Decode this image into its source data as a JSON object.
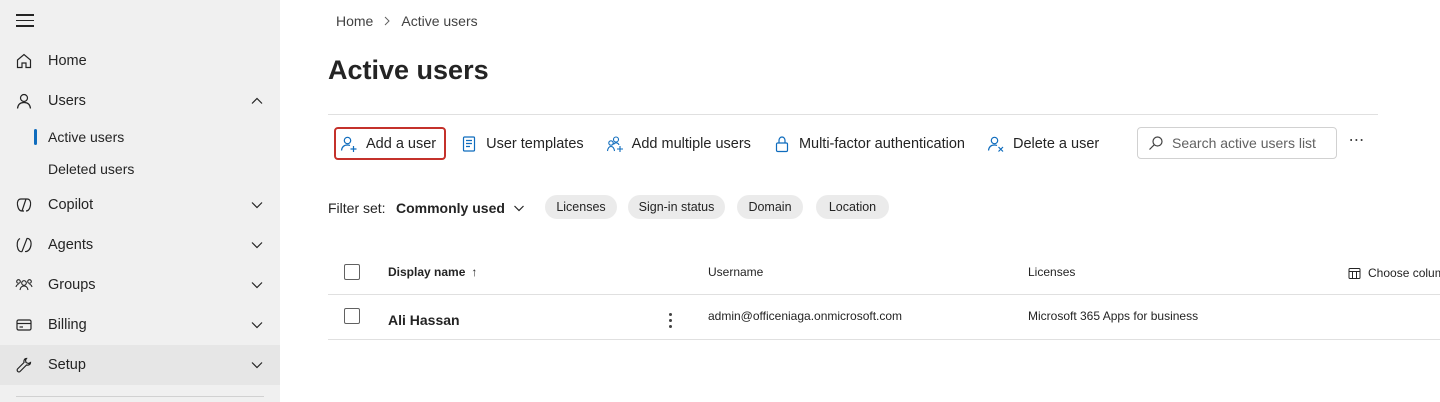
{
  "sidebar": {
    "menu_label": "Navigation menu",
    "items": [
      {
        "label": "Home"
      },
      {
        "label": "Users"
      },
      {
        "label": "Copilot"
      },
      {
        "label": "Agents"
      },
      {
        "label": "Groups"
      },
      {
        "label": "Billing"
      },
      {
        "label": "Setup"
      }
    ],
    "users_subitems": [
      {
        "label": "Active users"
      },
      {
        "label": "Deleted users"
      }
    ]
  },
  "breadcrumb": {
    "home": "Home",
    "current": "Active users"
  },
  "page": {
    "title": "Active users"
  },
  "toolbar": {
    "add_user": "Add a user",
    "user_templates": "User templates",
    "add_multiple": "Add multiple users",
    "mfa": "Multi-factor authentication",
    "delete_user": "Delete a user",
    "more": "⋯"
  },
  "search": {
    "placeholder": "Search active users list"
  },
  "filters": {
    "label": "Filter set:",
    "selected": "Commonly used",
    "chips": [
      "Licenses",
      "Sign-in status",
      "Domain",
      "Location"
    ]
  },
  "table": {
    "columns": {
      "display_name": "Display name",
      "sort_indicator": "↑",
      "username": "Username",
      "licenses": "Licenses",
      "choose_columns": "Choose columns"
    },
    "rows": [
      {
        "display_name": "Ali Hassan",
        "username": "admin@officeniaga.onmicrosoft.com",
        "licenses": "Microsoft 365 Apps for business"
      }
    ]
  },
  "colors": {
    "sidebar_bg": "#f0f0f0",
    "accent": "#0f6cbd",
    "highlight_border": "#c4312b",
    "icon": "#0f6cbd"
  }
}
